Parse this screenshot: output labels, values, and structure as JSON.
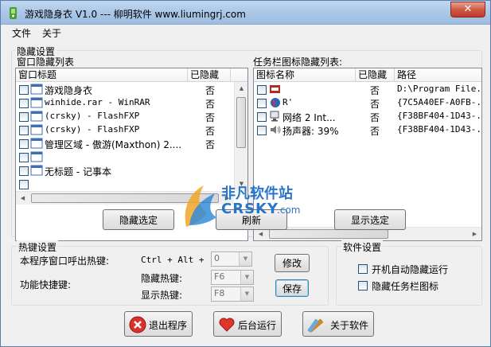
{
  "window": {
    "title": "游戏隐身衣 V1.0    --- 柳明软件 www.liumingrj.com",
    "close": "✕"
  },
  "menu": {
    "items": [
      "文件",
      "关于"
    ]
  },
  "hide_settings": {
    "legend": "隐藏设置",
    "window_list": {
      "label": "窗口隐藏列表",
      "columns": [
        "窗口标题",
        "已隐藏"
      ],
      "rows": [
        {
          "title": "游戏隐身衣",
          "hidden": "否"
        },
        {
          "title": "winhide.rar - WinRAR",
          "hidden": "否"
        },
        {
          "title": "(crsky) - FlashFXP",
          "hidden": "否"
        },
        {
          "title": "(crsky) - FlashFXP",
          "hidden": "否"
        },
        {
          "title": "管理区域 - 傲游(Maxthon) 2....",
          "hidden": "否"
        },
        {
          "title": "",
          "hidden": ""
        },
        {
          "title": "无标题 - 记事本",
          "hidden": ""
        },
        {
          "title": "",
          "hidden": ""
        }
      ]
    },
    "tray_list": {
      "label": "任务栏图标隐藏列表:",
      "columns": [
        "图标名称",
        "已隐藏",
        "路径"
      ],
      "rows": [
        {
          "name": "",
          "hidden": "否",
          "path": "D:\\Program File..."
        },
        {
          "name": "R'",
          "hidden": "否",
          "path": "{7C5A40EF-A0FB-..."
        },
        {
          "name": "网络  2 Int...",
          "hidden": "否",
          "path": "{F38BF404-1D43-..."
        },
        {
          "name": "扬声器: 39%",
          "hidden": "否",
          "path": "{F38BF404-1D43-..."
        }
      ]
    },
    "buttons": {
      "hide_selected": "隐藏选定",
      "refresh": "刷新",
      "show_selected": "显示选定"
    }
  },
  "hotkey_settings": {
    "legend": "热键设置",
    "call_label": "本程序窗口呼出热键:",
    "call_combo": "Ctrl + Alt +",
    "call_key": "0",
    "modify": "修改",
    "func_label": "功能快捷键:",
    "hide_label": "隐藏热键:",
    "hide_key": "F6",
    "show_label": "显示热键:",
    "show_key": "F8",
    "save": "保存"
  },
  "software_settings": {
    "legend": "软件设置",
    "autostart": "开机自动隐藏运行",
    "hide_tray": "隐藏任务栏图标"
  },
  "bottom_buttons": {
    "exit": "退出程序",
    "background": "后台运行",
    "about": "关于软件"
  },
  "watermark": {
    "line1": "非凡软件站",
    "line2": "CRSKY",
    "line3": ".com"
  },
  "colors": {
    "accent": "#1c5180",
    "watermark_blue": "#1f6fc6"
  }
}
